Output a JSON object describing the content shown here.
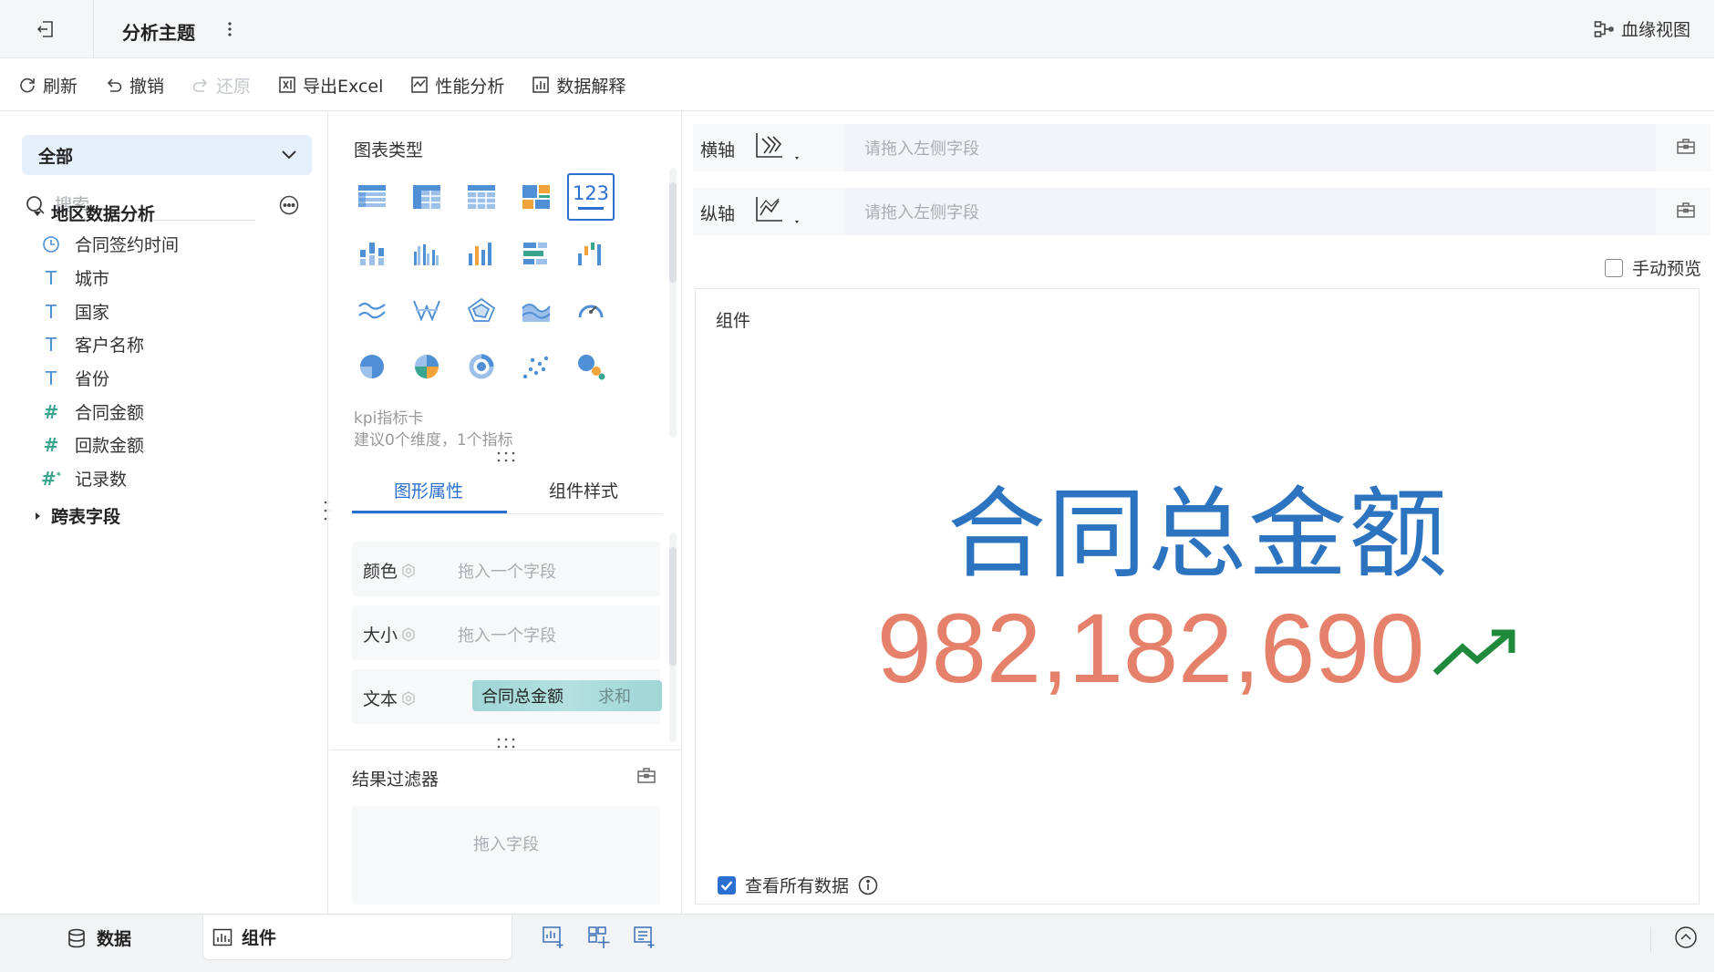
{
  "header": {
    "title": "分析主题",
    "lineage_label": "血缘视图"
  },
  "toolbar": {
    "refresh": "刷新",
    "undo": "撤销",
    "redo": "还原",
    "export_excel": "导出Excel",
    "perf_analysis": "性能分析",
    "data_explain": "数据解释"
  },
  "left_panel": {
    "scope": "全部",
    "search_placeholder": "搜索",
    "group_main": "地区数据分析",
    "fields": [
      {
        "label": "合同签约时间",
        "type": "time"
      },
      {
        "label": "城市",
        "type": "text"
      },
      {
        "label": "国家",
        "type": "text"
      },
      {
        "label": "客户名称",
        "type": "text"
      },
      {
        "label": "省份",
        "type": "text"
      },
      {
        "label": "合同金额",
        "type": "number"
      },
      {
        "label": "回款金额",
        "type": "number"
      },
      {
        "label": "记录数",
        "type": "number"
      }
    ],
    "group_cross": "跨表字段"
  },
  "mid_panel": {
    "chart_type_title": "图表类型",
    "chart_types": [
      "table",
      "cross-table",
      "detail-table",
      "color-block",
      "kpi-card",
      "stacked-bar",
      "grouped-bar",
      "bar",
      "horizontal-bar",
      "waterfall",
      "line",
      "radar-line",
      "radar",
      "area",
      "gauge",
      "pie",
      "multi-pie",
      "donut",
      "scatter",
      "bubble"
    ],
    "selected_chart": "kpi-card",
    "kpi_glyph": "123",
    "chart_hint_name": "kpi指标卡",
    "chart_hint_desc": "建议0个维度，1个指标",
    "tab_graphic": "图形属性",
    "tab_style": "组件样式",
    "prop_color": "颜色",
    "prop_size": "大小",
    "prop_text": "文本",
    "drop_one_field": "拖入一个字段",
    "text_field": "合同总金额",
    "text_agg": "求和",
    "filter_title": "结果过滤器",
    "filter_drop": "拖入字段"
  },
  "right_panel": {
    "x_axis_label": "横轴",
    "y_axis_label": "纵轴",
    "drop_left_field": "请拖入左侧字段",
    "manual_preview": "手动预览",
    "widget_title": "组件",
    "kpi_title": "合同总金额",
    "kpi_value": "982,182,690",
    "kpi_trend": "up",
    "view_all": "查看所有数据",
    "view_all_checked": true
  },
  "bottom_bar": {
    "tab_data": "数据",
    "tab_widget": "组件"
  },
  "colors": {
    "accent": "#2b6fd1",
    "kpi_title": "#2c74c0",
    "kpi_value": "#e5806a",
    "trend_up": "#1f8a3b",
    "text_pill": "#9fd6d6"
  }
}
